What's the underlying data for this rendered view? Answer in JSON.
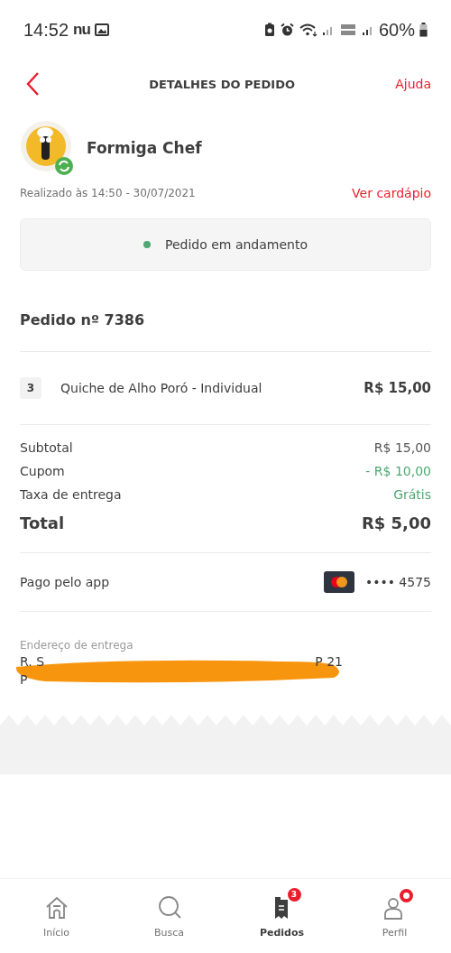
{
  "status_bar": {
    "time": "14:52",
    "carrier": "nu",
    "battery": "60%"
  },
  "header": {
    "title": "DETALHES DO PEDIDO",
    "help": "Ajuda"
  },
  "restaurant": {
    "name": "Formiga Chef",
    "placed": "Realizado às 14:50 - 30/07/2021",
    "menu_link": "Ver cardápio"
  },
  "order_status": {
    "text": "Pedido em andamento",
    "color": "#50a773"
  },
  "order": {
    "number": "Pedido nº 7386",
    "items": [
      {
        "quantity": "3",
        "name": "Quiche de Alho Poró - Individual",
        "price": "R$ 15,00"
      }
    ]
  },
  "summary": [
    {
      "label": "Subtotal",
      "value": "R$ 15,00",
      "kind": "plain"
    },
    {
      "label": "Cupom",
      "value": "- R$ 10,00",
      "kind": "discount"
    },
    {
      "label": "Taxa de entrega",
      "value": "Grátis",
      "kind": "discount"
    },
    {
      "label": "Total",
      "value": "R$ 5,00",
      "kind": "total"
    }
  ],
  "payment": {
    "label": "Pago pelo app",
    "card": "•••• 4575"
  },
  "address": {
    "label": "Endereço de entrega",
    "line_1_start": "R. S",
    "line_1_end": "P 21",
    "line_2_start": "P",
    "redacted": true
  },
  "nav": [
    {
      "label": "Início",
      "kind": "home",
      "selected": false
    },
    {
      "label": "Busca",
      "kind": "search",
      "selected": false
    },
    {
      "label": "Pedidos",
      "kind": "orders",
      "selected": true,
      "badge": "3"
    },
    {
      "label": "Perfil",
      "kind": "profile",
      "selected": false,
      "dot": true
    }
  ]
}
